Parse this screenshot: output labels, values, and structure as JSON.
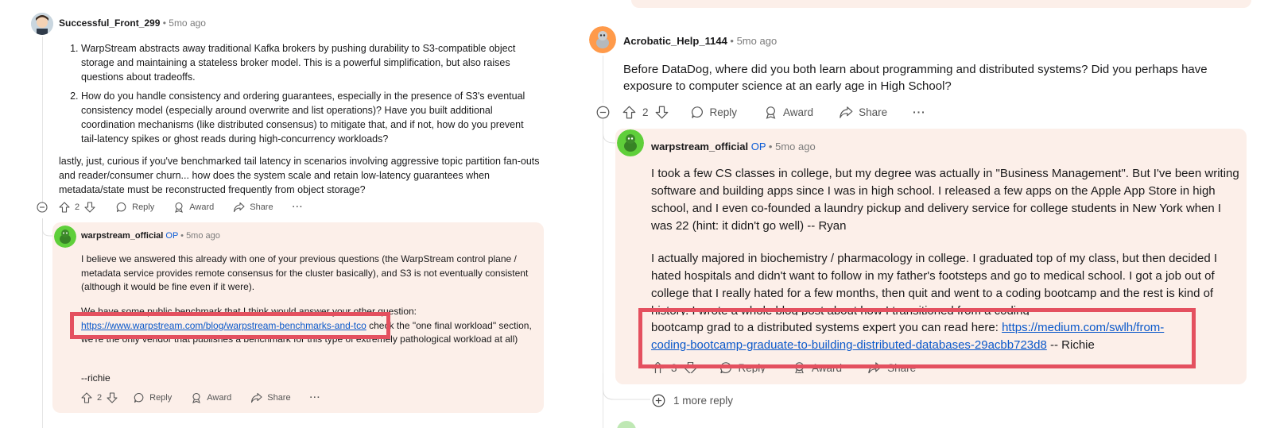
{
  "left": {
    "comment1": {
      "username": "Successful_Front_299",
      "time": "5mo ago",
      "list": [
        "WarpStream abstracts away traditional Kafka brokers by pushing durability to S3-compatible object storage and maintaining a stateless broker model. This is a powerful simplification, but also raises questions about tradeoffs.",
        "How do you handle consistency and ordering guarantees, especially in the presence of S3's eventual consistency model (especially around overwrite and list operations)? Have you built additional coordination mechanisms (like distributed consensus) to mitigate that, and if not, how do you prevent tail-latency spikes or ghost reads during high-concurrency workloads?"
      ],
      "para": "lastly, just, curious if you've benchmarked tail latency in scenarios involving aggressive topic partition fan-outs and reader/consumer churn... how does the system scale and retain low-latency guarantees when metadata/state must be reconstructed frequently from object storage?",
      "votes": "2",
      "reply": "Reply",
      "award": "Award",
      "share": "Share",
      "more": "···"
    },
    "reply1": {
      "username": "warpstream_official",
      "op": "OP",
      "time": "5mo ago",
      "p1": "I believe we answered this already with one of your previous questions (the WarpStream control plane / metadata service provides remote consensus for the cluster basically), and S3 is not eventually consistent (although it would be fine even if it were).",
      "p2_start": "We have some public benchmark that I think would answer your other question:",
      "link": "https://www.warpstream.com/blog/warpstream-benchmarks-and-tco",
      "p2_after": " check the \"one final workload\"",
      "p2_rest": "section, we're the only vendor that publishes a benchmark for this type of extremely pathological workload at all)",
      "sign": "--richie",
      "votes": "2",
      "reply": "Reply",
      "award": "Award",
      "share": "Share",
      "more": "···"
    }
  },
  "right": {
    "comment1": {
      "username": "Acrobatic_Help_1144",
      "time": "5mo ago",
      "text": "Before DataDog, where did you both learn about programming and distributed systems? Did you perhaps have exposure to computer science at an early age in High School?",
      "votes": "2",
      "reply": "Reply",
      "award": "Award",
      "share": "Share",
      "more": "···"
    },
    "reply1": {
      "username": "warpstream_official",
      "op": "OP",
      "time": "5mo ago",
      "p1": "I took a few CS classes in college, but my degree was actually in \"Business Management\". But I've been writing software and building apps since I was in high school. I released a few apps on the Apple App Store in high school, and I even co-founded a laundry pickup and delivery service for college students in New York when I was 22 (hint: it didn't go well) -- Ryan",
      "p2": "I actually majored in biochemistry / pharmacology in college. I graduated top of my class, but then decided I hated hospitals and didn't want to follow in my father's footsteps and go to medical school. I got a job out of college that I really hated for a few months, then quit and went to a coding bootcamp and the rest is kind of history. I wrote a whole blog post about how I transitioned from a coding",
      "p3_start": "bootcamp grad to a distributed systems expert you can read here: ",
      "link": "https://medium.com/swlh/from-coding-bootcamp-graduate-to-building-distributed-databases-29acbb723d8",
      "p3_end": " -- Richie",
      "votes": "3",
      "reply": "Reply",
      "award": "Award",
      "share": "Share"
    },
    "more_replies": "1 more reply"
  }
}
